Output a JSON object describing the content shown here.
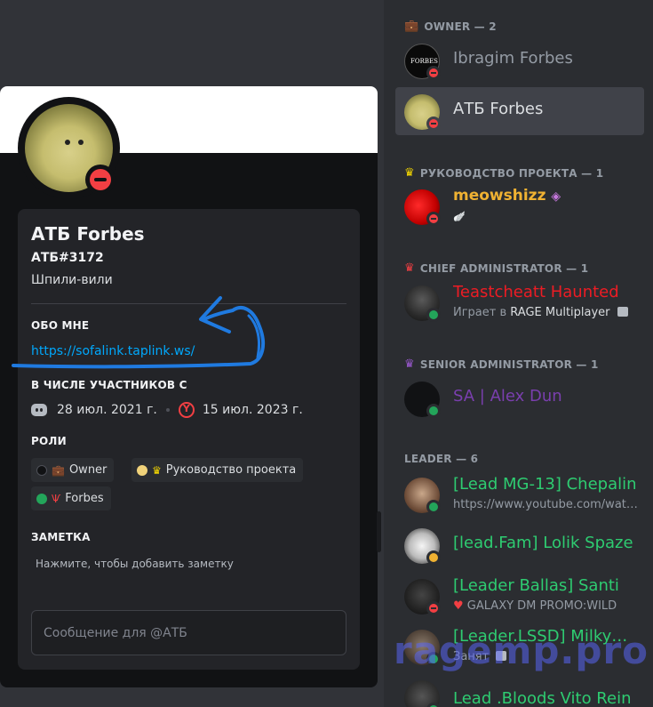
{
  "profile": {
    "display_name": "АТБ Forbes",
    "tag": "АТБ#3172",
    "custom_status": "Шпили-вили",
    "about_heading": "ОБО МНЕ",
    "about_link": "https://sofalink.taplink.ws/",
    "member_since_heading": "В ЧИСЛЕ УЧАСТНИКОВ С",
    "discord_since": "28 июл. 2021 г.",
    "server_since": "15 июл. 2023 г.",
    "roles_heading": "РОЛИ",
    "roles": [
      {
        "label": "Owner",
        "color": "#111214",
        "icon": "owner-emoji"
      },
      {
        "label": "Руководство проекта",
        "color": "#f0d27a",
        "icon": "crown-emoji"
      },
      {
        "label": "Forbes",
        "color": "#23a55a",
        "icon": "forbes-emoji"
      }
    ],
    "note_heading": "ЗАМЕТКА",
    "note_hint": "Нажмите, чтобы добавить заметку",
    "message_placeholder": "Сообщение для @АТБ"
  },
  "members": {
    "groups": [
      {
        "label": "OWNER — 2"
      },
      {
        "label": "РУКОВОДСТВО ПРОЕКТА — 1"
      },
      {
        "label": "CHIEF ADMINISTRATOR — 1"
      },
      {
        "label": "SENIOR ADMINISTRATOR — 1"
      },
      {
        "label": "LEADER — 6"
      }
    ],
    "list": [
      {
        "name": "Ibragim Forbes",
        "sub": "",
        "color": "#949ba4",
        "status": "dnd"
      },
      {
        "name": "АТБ Forbes",
        "sub": "",
        "color": "#dbdee1",
        "status": "dnd"
      },
      {
        "name": "meowshizz",
        "sub": "",
        "color": "#f0b232",
        "status": "dnd"
      },
      {
        "name": "Teastcheatt Haunted",
        "sub_prefix": "Играет в ",
        "sub_bold": "RAGE Multiplayer",
        "color": "#ed1c24",
        "status": "online"
      },
      {
        "name": "SA | Alex Dun",
        "sub": "",
        "color": "#7a3fae",
        "status": "online"
      },
      {
        "name": "[Lead MG-13] Chepalin",
        "sub": "https://www.youtube.com/watch",
        "color": "#2ecc71",
        "status": "online"
      },
      {
        "name": "[lead.Fam] Lolik Spaze",
        "sub": "",
        "color": "#2ecc71",
        "status": "idle"
      },
      {
        "name": "[Leader Ballas] Santi",
        "sub": "GALAXY DM PROMO:WILD",
        "color": "#2ecc71",
        "status": "dnd"
      },
      {
        "name": "[Leader.LSSD] Milkyway",
        "sub": "Занят",
        "color": "#2ecc71",
        "status": "online"
      },
      {
        "name": "Lead .Bloods Vito Rein",
        "sub": "",
        "color": "#2ecc71",
        "status": "online"
      }
    ]
  },
  "watermark": "ragemp.pro"
}
